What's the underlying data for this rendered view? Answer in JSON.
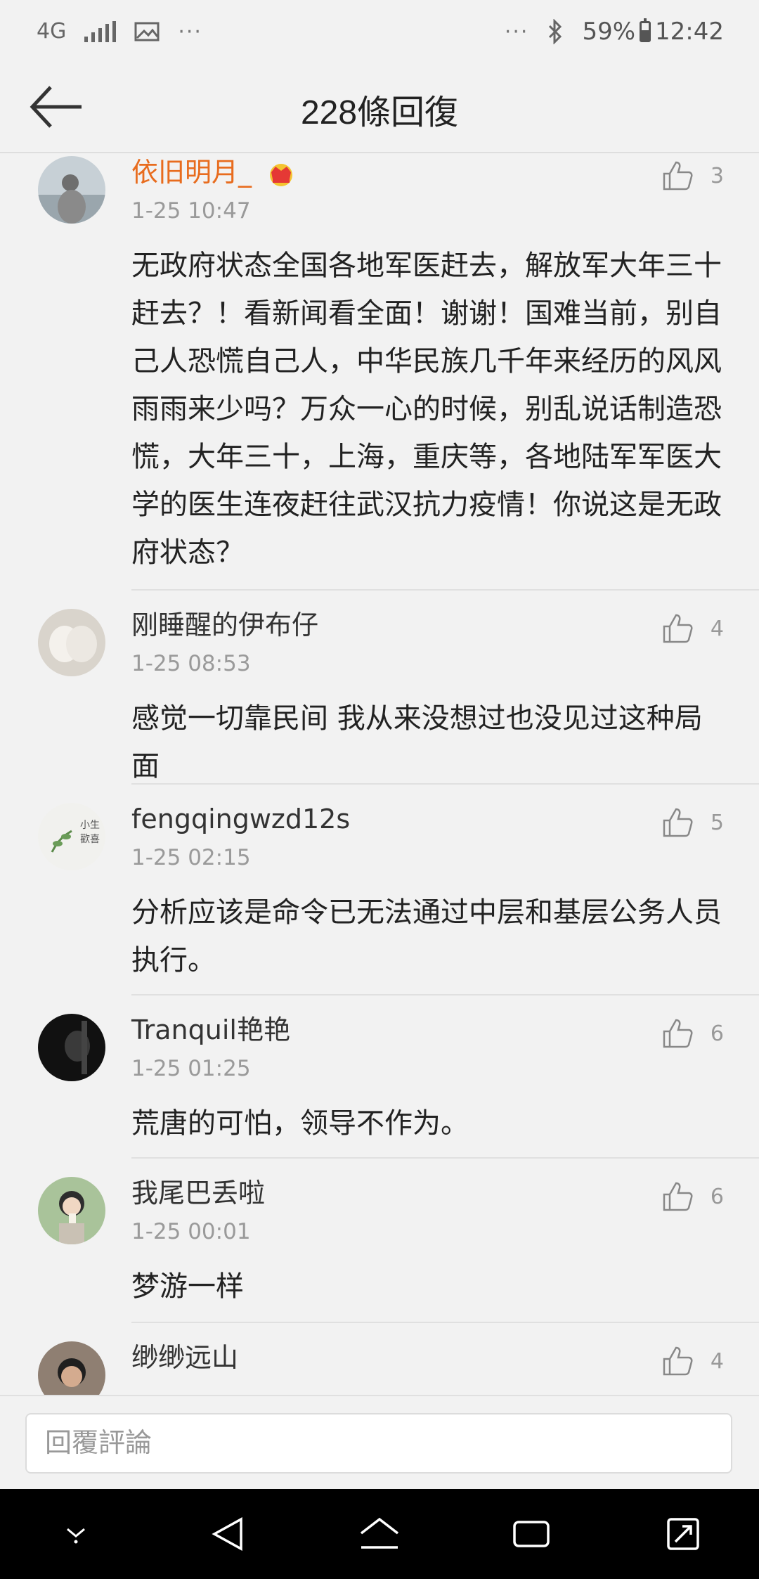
{
  "status_bar": {
    "network": "4G",
    "dots_left": "···",
    "dots_right": "···",
    "battery": "59%",
    "time": "12:42"
  },
  "header": {
    "title": "228條回復"
  },
  "comments": [
    {
      "name": "依旧明月_",
      "vip": true,
      "time": "1-25 10:47",
      "likes": "3",
      "text": "无政府状态全国各地军医赶去，解放军大年三十赶去？！看新闻看全面！谢谢！国难当前，别自己人恐慌自己人，中华民族几千年来经历的风风雨雨来少吗？万众一心的时候，别乱说话制造恐慌，大年三十，上海，重庆等，各地陆军军医大学的医生连夜赶往武汉抗力疫情！你说这是无政府状态？"
    },
    {
      "name": "刚睡醒的伊布仔",
      "vip": false,
      "time": "1-25 08:53",
      "likes": "4",
      "text": "感觉一切靠民间 我从来没想过也没见过这种局面"
    },
    {
      "name": "fengqingwzd12s",
      "vip": false,
      "time": "1-25 02:15",
      "likes": "5",
      "text": "分析应该是命令已无法通过中层和基层公务人员执行。"
    },
    {
      "name": "Tranquil艳艳",
      "vip": false,
      "time": "1-25 01:25",
      "likes": "6",
      "text": "荒唐的可怕，领导不作为。"
    },
    {
      "name": "我尾巴丢啦",
      "vip": false,
      "time": "1-25 00:01",
      "likes": "6",
      "text": "梦游一样"
    },
    {
      "name": "缈缈远山",
      "vip": false,
      "time": "",
      "likes": "4",
      "text": ""
    }
  ],
  "reply_bar": {
    "placeholder": "回覆評論"
  },
  "colors": {
    "vip_name": "#e86c1e",
    "background": "#f2f2f2"
  },
  "icons": [
    "back-arrow-icon",
    "thumbs-up-icon",
    "crown-icon",
    "bluetooth-icon",
    "image-icon",
    "signal-icon",
    "battery-icon"
  ]
}
